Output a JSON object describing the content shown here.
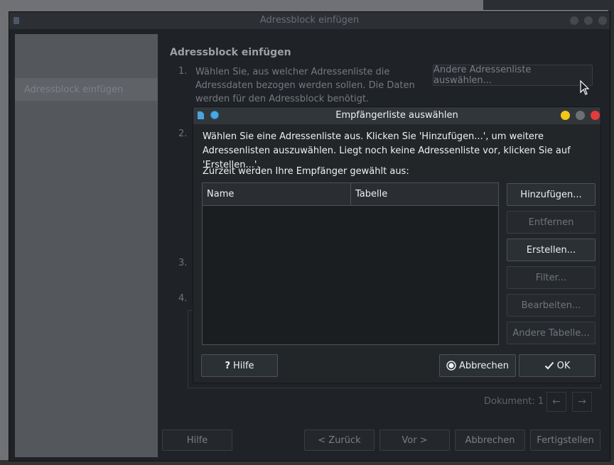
{
  "background_window": {
    "title": "Adressblock einfügen",
    "sidebar_item": "Adressblock einfügen",
    "heading": "Adressblock einfügen",
    "steps": [
      {
        "number": "1.",
        "text": "Wählen Sie, aus welcher Adressenliste die Adressdaten bezogen werden sollen. Die Daten werden für den Adressblock benötigt."
      },
      {
        "number": "2."
      },
      {
        "number": "3."
      },
      {
        "number": "4."
      }
    ],
    "select_list_button": "Andere Adressenliste auswählen...",
    "document_label": "Dokument: 1",
    "footer": {
      "help": "Hilfe",
      "back": "< Zurück",
      "next": "Vor >",
      "cancel": "Abbrechen",
      "finish": "Fertigstellen"
    }
  },
  "dialog": {
    "title": "Empfängerliste auswählen",
    "description": "Wählen Sie eine Adressenliste aus. Klicken Sie 'Hinzufügen...', um weitere Adressenlisten auszuwählen. Liegt noch keine Adressenliste vor, klicken Sie auf 'Erstellen...'.",
    "subtitle": "Zurzeit werden Ihre Empfänger gewählt aus:",
    "table": {
      "columns": [
        "Name",
        "Tabelle"
      ],
      "rows": []
    },
    "side_buttons": {
      "add": "Hinzufügen...",
      "remove": "Entfernen",
      "create": "Erstellen...",
      "filter": "Filter...",
      "edit": "Bearbeiten...",
      "other_table": "Andere Tabelle..."
    },
    "footer": {
      "help": "Hilfe",
      "cancel": "Abbrechen",
      "ok": "OK"
    }
  },
  "colors": {
    "accent": "#48a9e6",
    "minimize": "#f5c518",
    "maximize": "#6b7075",
    "close": "#e33b3b"
  }
}
